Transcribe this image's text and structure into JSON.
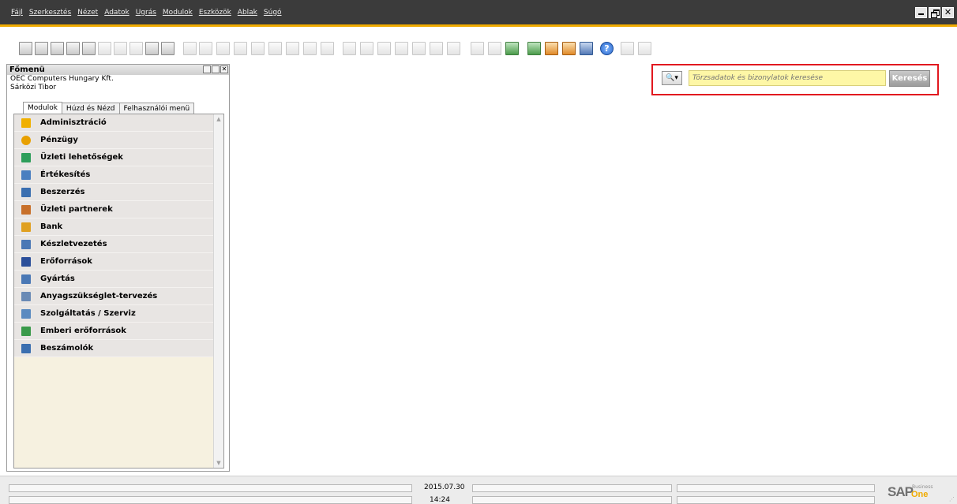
{
  "menubar": {
    "items": [
      "Fájl",
      "Szerkesztés",
      "Nézet",
      "Adatok",
      "Ugrás",
      "Modulok",
      "Eszközök",
      "Ablak",
      "Súgó"
    ],
    "bg_color": "#3b3b3b",
    "accent_color": "#f0ab00"
  },
  "window_controls": {
    "minimize": "minimize-icon",
    "restore": "restore-icon",
    "close": "close-icon",
    "close_glyph": "✕"
  },
  "toolbar": {
    "icons": [
      "print-preview-icon",
      "print-icon",
      "email-icon",
      "sms-icon",
      "fax-icon",
      "export-excel-icon",
      "export-word-icon",
      "export-pdf-icon",
      "launch-app-icon",
      "lock-screen-icon",
      "find-icon",
      "add-icon",
      "first-record-icon",
      "previous-record-icon",
      "next-record-icon",
      "last-record-icon",
      "refresh-icon",
      "filter-icon",
      "sort-icon",
      "base-document-icon",
      "target-document-icon",
      "journal-icon",
      "payment-means-icon",
      "gross-profit-icon",
      "volume-weight-icon",
      "freight-icon",
      "settings-icon",
      "form-settings-icon",
      "user-authorization-icon",
      "calendar-icon",
      "messages-icon",
      "financial-report-icon",
      "org-chart-icon",
      "help-icon",
      "pictures-icon",
      "drafts-icon"
    ],
    "help_glyph": "?"
  },
  "main_menu": {
    "title": "Főmenü",
    "company": "OEC Computers Hungary Kft.",
    "user": "Sárközi Tibor",
    "tabs": [
      {
        "label": "Modulok",
        "active": true
      },
      {
        "label": "Húzd és Nézd",
        "active": false
      },
      {
        "label": "Felhasználói menü",
        "active": false
      }
    ],
    "modules": [
      {
        "label": "Adminisztráció",
        "icon": "administration-icon",
        "color": "#f0b000"
      },
      {
        "label": "Pénzügy",
        "icon": "finance-icon",
        "color": "#e8a000"
      },
      {
        "label": "Üzleti lehetőségek",
        "icon": "opportunities-icon",
        "color": "#2e9e5a"
      },
      {
        "label": "Értékesítés",
        "icon": "sales-icon",
        "color": "#4a7fc0"
      },
      {
        "label": "Beszerzés",
        "icon": "purchasing-icon",
        "color": "#3b6fb0"
      },
      {
        "label": "Üzleti partnerek",
        "icon": "business-partners-icon",
        "color": "#c8702a"
      },
      {
        "label": "Bank",
        "icon": "banking-icon",
        "color": "#e0a020"
      },
      {
        "label": "Készletvezetés",
        "icon": "inventory-icon",
        "color": "#4a78b5"
      },
      {
        "label": "Erőforrások",
        "icon": "resources-icon",
        "color": "#2b4f9a"
      },
      {
        "label": "Gyártás",
        "icon": "production-icon",
        "color": "#4a78b5"
      },
      {
        "label": "Anyagszükséglet-tervezés",
        "icon": "mrp-icon",
        "color": "#6a8ab5"
      },
      {
        "label": "Szolgáltatás / Szerviz",
        "icon": "service-icon",
        "color": "#5a8ac0"
      },
      {
        "label": "Emberi erőforrások",
        "icon": "human-resources-icon",
        "color": "#3a9a4a"
      },
      {
        "label": "Beszámolók",
        "icon": "reports-icon",
        "color": "#3b6fb0"
      }
    ],
    "scroll_up": "▲",
    "scroll_down": "▼"
  },
  "search": {
    "dropdown_glyph": "🔍▾",
    "placeholder": "Törzsadatok és bizonylatok keresése",
    "button_label": "Keresés",
    "highlight_color": "#e2181f"
  },
  "status_bar": {
    "date": "2015.07.30",
    "time": "14:24",
    "logo_text": "SAP",
    "logo_business": "Business",
    "logo_one": "One"
  }
}
